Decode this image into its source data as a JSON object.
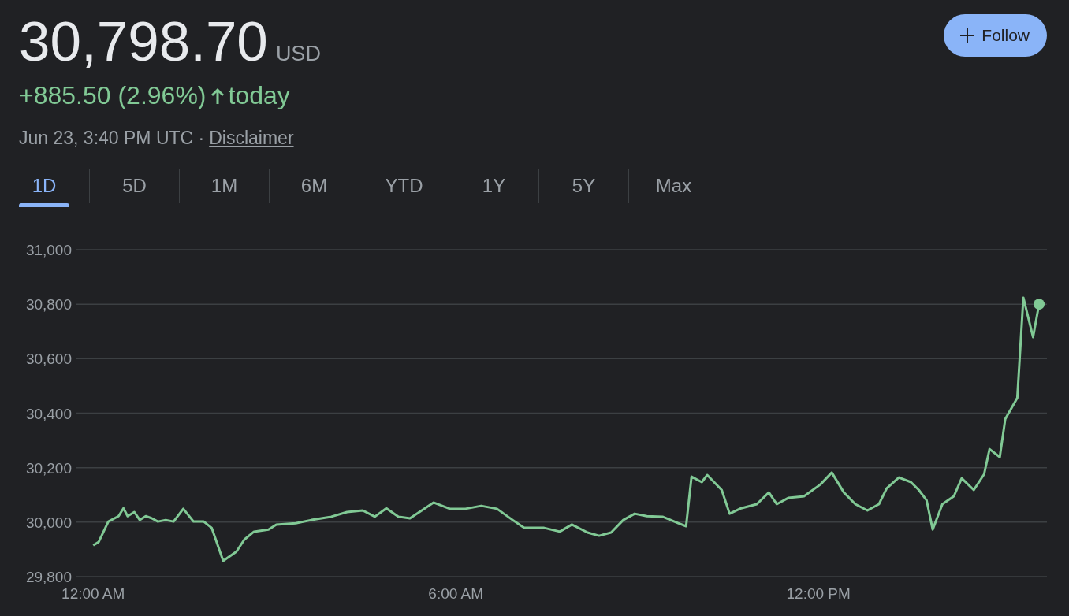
{
  "quote": {
    "price": "30,798.70",
    "currency": "USD",
    "change": "+885.50 (2.96%)",
    "change_period": "today",
    "timestamp": "Jun 23, 3:40 PM UTC ·",
    "disclaimer": "Disclaimer"
  },
  "follow_button": {
    "label": "Follow"
  },
  "tabs": [
    {
      "label": "1D",
      "selected": true
    },
    {
      "label": "5D",
      "selected": false
    },
    {
      "label": "1M",
      "selected": false
    },
    {
      "label": "6M",
      "selected": false
    },
    {
      "label": "YTD",
      "selected": false
    },
    {
      "label": "1Y",
      "selected": false
    },
    {
      "label": "5Y",
      "selected": false
    },
    {
      "label": "Max",
      "selected": false
    }
  ],
  "chart": {
    "chart_data": {
      "type": "line",
      "x": [
        0,
        0.09,
        0.25,
        0.42,
        0.5,
        0.57,
        0.68,
        0.77,
        0.87,
        0.97,
        1.07,
        1.2,
        1.33,
        1.49,
        1.66,
        1.83,
        1.96,
        2.15,
        2.37,
        2.5,
        2.66,
        2.9,
        3.03,
        3.35,
        3.61,
        3.94,
        4.2,
        4.46,
        4.66,
        4.85,
        5.05,
        5.24,
        5.63,
        5.9,
        6.16,
        6.42,
        6.68,
        6.94,
        7.13,
        7.46,
        7.72,
        7.92,
        8.18,
        8.37,
        8.57,
        8.77,
        8.96,
        9.16,
        9.42,
        9.68,
        9.81,
        9.9,
        10.07,
        10.16,
        10.4,
        10.53,
        10.72,
        10.98,
        11.18,
        11.31,
        11.5,
        11.76,
        12.03,
        12.22,
        12.42,
        12.61,
        12.81,
        13,
        13.13,
        13.33,
        13.53,
        13.66,
        13.79,
        13.89,
        14.05,
        14.24,
        14.37,
        14.57,
        14.74,
        14.83,
        15,
        15.09,
        15.29,
        15.39,
        15.55,
        15.65
      ],
      "series": [
        {
          "color": "#81c995",
          "values": [
            29915,
            29927,
            30002,
            30022,
            30051,
            30022,
            30037,
            30008,
            30022,
            30014,
            30002,
            30008,
            30002,
            30049,
            30002,
            30002,
            29979,
            29858,
            29892,
            29936,
            29965,
            29973,
            29991,
            29996,
            30008,
            30020,
            30037,
            30043,
            30020,
            30051,
            30020,
            30014,
            30072,
            30049,
            30049,
            30060,
            30049,
            30008,
            29979,
            29979,
            29965,
            29991,
            29962,
            29950,
            29962,
            30008,
            30031,
            30022,
            30020,
            29996,
            29985,
            30167,
            30147,
            30173,
            30118,
            30031,
            30051,
            30066,
            30109,
            30066,
            30089,
            30095,
            30138,
            30182,
            30109,
            30066,
            30043,
            30066,
            30124,
            30164,
            30147,
            30118,
            30080,
            29973,
            30066,
            30095,
            30161,
            30118,
            30176,
            30268,
            30239,
            30378,
            30456,
            30824,
            30679,
            30800
          ]
        }
      ],
      "xlim": [
        -0.29,
        15.78
      ],
      "ylim": [
        29800,
        31000
      ],
      "grid": true,
      "xticks": [
        {
          "value": 0,
          "label": "12:00 AM"
        },
        {
          "value": 6,
          "label": "6:00 AM"
        },
        {
          "value": 12,
          "label": "12:00 PM"
        }
      ],
      "yticks": [
        {
          "value": 29800,
          "label": "29,800"
        },
        {
          "value": 30000,
          "label": "30,000"
        },
        {
          "value": 30200,
          "label": "30,200"
        },
        {
          "value": 30400,
          "label": "30,400"
        },
        {
          "value": 30600,
          "label": "30,600"
        },
        {
          "value": 30800,
          "label": "30,800"
        },
        {
          "value": 31000,
          "label": "31,000"
        }
      ]
    }
  }
}
